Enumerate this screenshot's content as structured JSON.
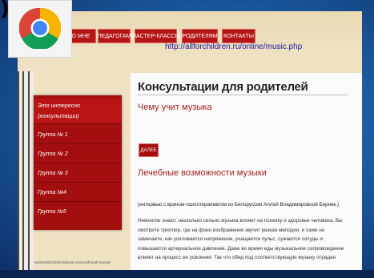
{
  "browser": {
    "icon": "chrome-icon",
    "corner_char": ")"
  },
  "nav": {
    "items": [
      {
        "label": "О МНЕ"
      },
      {
        "label": "ПЕДАГОГАМ"
      },
      {
        "label": "МАСТЕР-КЛАССЫ"
      },
      {
        "label": "РОДИТЕЛЯМ"
      },
      {
        "label": "КОНТАКТЫ"
      }
    ]
  },
  "url_overlay": "http://allforchildren.ru/online/music.php",
  "sidebar": {
    "items": [
      {
        "label": "Это интересно (консультации)"
      },
      {
        "label": "Группа № 1"
      },
      {
        "label": "Группа № 2"
      },
      {
        "label": "Группа № 3"
      },
      {
        "label": "Группа №4"
      },
      {
        "label": "Группа №5"
      }
    ]
  },
  "main": {
    "title": "Консультации для родителей",
    "section1_title": "Чему учит музыка",
    "more_label": "ДАЛЕЕ",
    "section2_title": "Лечебные возможности музыки",
    "interview_note": "(интервью с врачом-психотерапевтом из Белоруссии Аллой Владимировной Берняк.)",
    "paragraph": "Немногие знают, насколько сильно музыка влияет на психику и здоровье человека. Вы смотрите триллер, где на фоне изображения звучит резкая мелодия, и сами не замечаете, как усиливается напряжение, учащается пульс, сужаются сосуды и повышается артериальное давление. Даже во время еды музыкальное сопровождение влияет на процесс ее усвоения. Так что обед под соответствующую музыку отрадан"
  },
  "status_text": "ru/2015/02/12/lechebnye-vozmozhnosti-muzyki",
  "colors": {
    "accent_red": "#a30f0f",
    "link_blue": "#1a1aa0",
    "background_blue": "#1c5ea6"
  }
}
